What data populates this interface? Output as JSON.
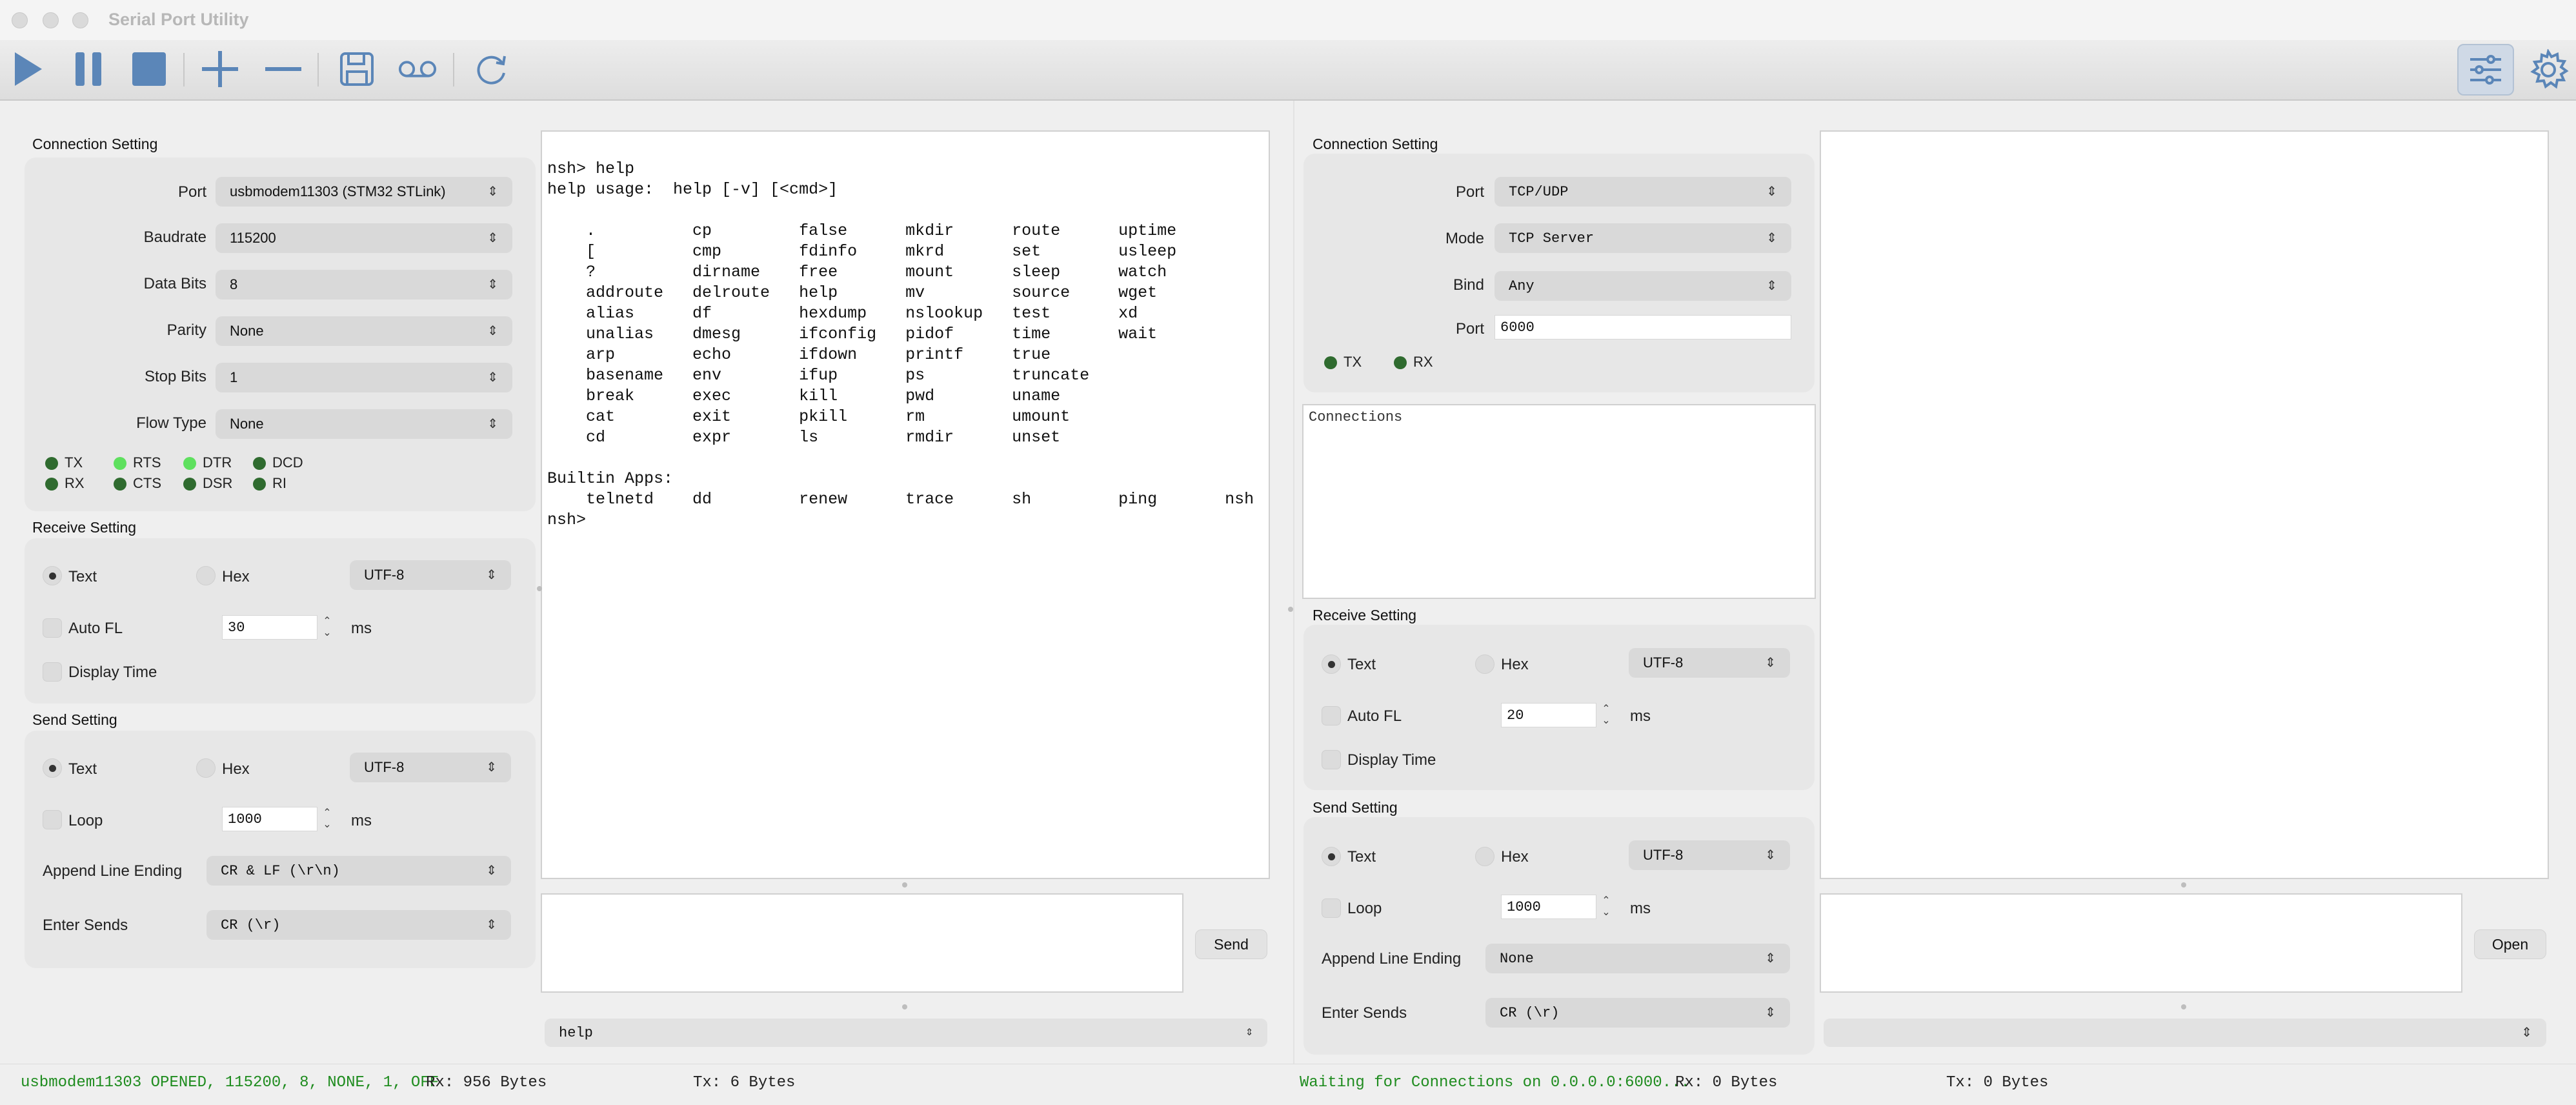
{
  "window": {
    "title": "Serial Port Utility"
  },
  "toolbar": {
    "icons": [
      "play-icon",
      "pause-icon",
      "stop-icon",
      "plus-icon",
      "minus-icon",
      "save-icon",
      "voicemail-icon",
      "refresh-icon",
      "sliders-icon",
      "gear-icon"
    ]
  },
  "left": {
    "connection": {
      "title": "Connection Setting",
      "port_label": "Port",
      "port_value": "usbmodem11303 (STM32 STLink)",
      "baud_label": "Baudrate",
      "baud_value": "115200",
      "databits_label": "Data Bits",
      "databits_value": "8",
      "parity_label": "Parity",
      "parity_value": "None",
      "stopbits_label": "Stop Bits",
      "stopbits_value": "1",
      "flow_label": "Flow Type",
      "flow_value": "None",
      "signals": [
        {
          "name": "TX",
          "on": false
        },
        {
          "name": "RTS",
          "on": true
        },
        {
          "name": "DTR",
          "on": true
        },
        {
          "name": "DCD",
          "on": false
        },
        {
          "name": "RX",
          "on": false
        },
        {
          "name": "CTS",
          "on": false
        },
        {
          "name": "DSR",
          "on": false
        },
        {
          "name": "RI",
          "on": false
        }
      ]
    },
    "receive": {
      "title": "Receive Setting",
      "text_label": "Text",
      "hex_label": "Hex",
      "encoding": "UTF-8",
      "autofl_label": "Auto FL",
      "autofl_value": "30",
      "autofl_unit": "ms",
      "displaytime_label": "Display Time"
    },
    "send": {
      "title": "Send Setting",
      "text_label": "Text",
      "hex_label": "Hex",
      "encoding": "UTF-8",
      "loop_label": "Loop",
      "loop_value": "1000",
      "loop_unit": "ms",
      "append_label": "Append Line Ending",
      "append_value": "CR & LF (\\r\\n)",
      "enter_label": "Enter Sends",
      "enter_value": "CR (\\r)"
    },
    "terminal_lines": [
      "nsh> help",
      "help usage:  help [-v] [<cmd>]",
      "",
      "    .          cp         false      mkdir      route      uptime",
      "    [          cmp        fdinfo     mkrd       set        usleep",
      "    ?          dirname    free       mount      sleep      watch",
      "    addroute   delroute   help       mv         source     wget",
      "    alias      df         hexdump    nslookup   test       xd",
      "    unalias    dmesg      ifconfig   pidof      time       wait",
      "    arp        echo       ifdown     printf     true",
      "    basename   env        ifup       ps         truncate",
      "    break      exec       kill       pwd        uname",
      "    cat        exit       pkill      rm         umount",
      "    cd         expr       ls         rmdir      unset",
      "",
      "Builtin Apps:",
      "    telnetd    dd         renew      trace      sh         ping       nsh",
      "nsh>"
    ],
    "send_button": "Send",
    "history_value": "help",
    "status": {
      "port": "usbmodem11303 OPENED, 115200, 8, NONE, 1, OFF",
      "rx": "Rx: 956 Bytes",
      "tx": "Tx: 6 Bytes"
    }
  },
  "right": {
    "connection": {
      "title": "Connection Setting",
      "port_label": "Port",
      "port_value": "TCP/UDP",
      "mode_label": "Mode",
      "mode_value": "TCP Server",
      "bind_label": "Bind",
      "bind_value": "Any",
      "portnum_label": "Port",
      "portnum_value": "6000",
      "signals": [
        {
          "name": "TX",
          "on": false
        },
        {
          "name": "RX",
          "on": false
        }
      ]
    },
    "connections_label": "Connections",
    "receive": {
      "title": "Receive Setting",
      "text_label": "Text",
      "hex_label": "Hex",
      "encoding": "UTF-8",
      "autofl_label": "Auto FL",
      "autofl_value": "20",
      "autofl_unit": "ms",
      "displaytime_label": "Display Time"
    },
    "send": {
      "title": "Send Setting",
      "text_label": "Text",
      "hex_label": "Hex",
      "encoding": "UTF-8",
      "loop_label": "Loop",
      "loop_value": "1000",
      "loop_unit": "ms",
      "append_label": "Append Line Ending",
      "append_value": "None",
      "enter_label": "Enter Sends",
      "enter_value": "CR (\\r)"
    },
    "open_button": "Open",
    "status": {
      "port": "Waiting for Connections on 0.0.0.0:6000...",
      "rx": "Rx: 0 Bytes",
      "tx": "Tx: 0 Bytes"
    }
  },
  "colors": {
    "accent": "#5b86b8",
    "led_off": "#2f6b2f",
    "led_on": "#5ee05e",
    "status_green": "#1f8c1f"
  }
}
